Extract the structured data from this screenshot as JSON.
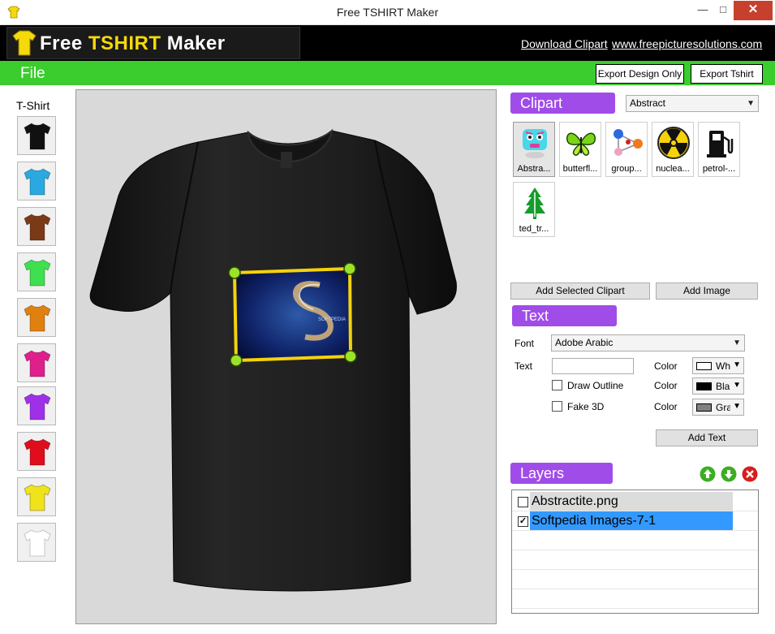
{
  "window": {
    "title": "Free TSHIRT Maker"
  },
  "header": {
    "logo_prefix": "Free ",
    "logo_accent": "TSHIRT",
    "logo_suffix": " Maker",
    "link_clipart": "Download Clipart",
    "link_site": "www.freepicturesolutions.com"
  },
  "menubar": {
    "file_label": "File",
    "export_design_label": "Export Design Only",
    "export_tshirt_label": "Export Tshirt"
  },
  "tshirt_panel": {
    "label": "T-Shirt",
    "colors": [
      "#111111",
      "#29a9e0",
      "#7a3a17",
      "#3ee04f",
      "#e0800f",
      "#e01f8c",
      "#a030e8",
      "#e00d1c",
      "#f0e21b",
      "#ffffff"
    ]
  },
  "canvas": {
    "shirt_color": "#1c1c1c",
    "image_caption": "SOFTPEDIA"
  },
  "clipart": {
    "header": "Clipart",
    "category": "Abstract",
    "items": [
      {
        "label": "Abstra...",
        "icon": "abstract-face-icon"
      },
      {
        "label": "butterfl...",
        "icon": "butterfly-icon"
      },
      {
        "label": "group...",
        "icon": "group-network-icon"
      },
      {
        "label": "nuclea...",
        "icon": "nuclear-icon"
      },
      {
        "label": "petrol-...",
        "icon": "petrol-pump-icon"
      },
      {
        "label": "ted_tr...",
        "icon": "tree-icon"
      }
    ],
    "add_selected_label": "Add Selected Clipart",
    "add_image_label": "Add Image"
  },
  "text_panel": {
    "header": "Text",
    "font_label": "Font",
    "font_value": "Adobe Arabic",
    "text_label": "Text",
    "text_value": "",
    "color_label": "Color",
    "text_color": {
      "name": "White",
      "hex": "#ffffff"
    },
    "draw_outline_label": "Draw Outline",
    "outline_color": {
      "name": "Black",
      "hex": "#000000"
    },
    "fake3d_label": "Fake 3D",
    "fake3d_color": {
      "name": "Gray",
      "hex": "#808080"
    },
    "add_text_label": "Add Text"
  },
  "layers": {
    "header": "Layers",
    "items": [
      {
        "name": "Abstractite.png",
        "checked": false
      },
      {
        "name": "Softpedia Images-7-1",
        "checked": true
      }
    ]
  },
  "colors": {
    "green_bar": "#3bcc2e",
    "purple_header": "#a04ce8",
    "selection_blue": "#3399ff",
    "handle_green": "#9be22a",
    "frame_yellow": "#f5d20a"
  }
}
